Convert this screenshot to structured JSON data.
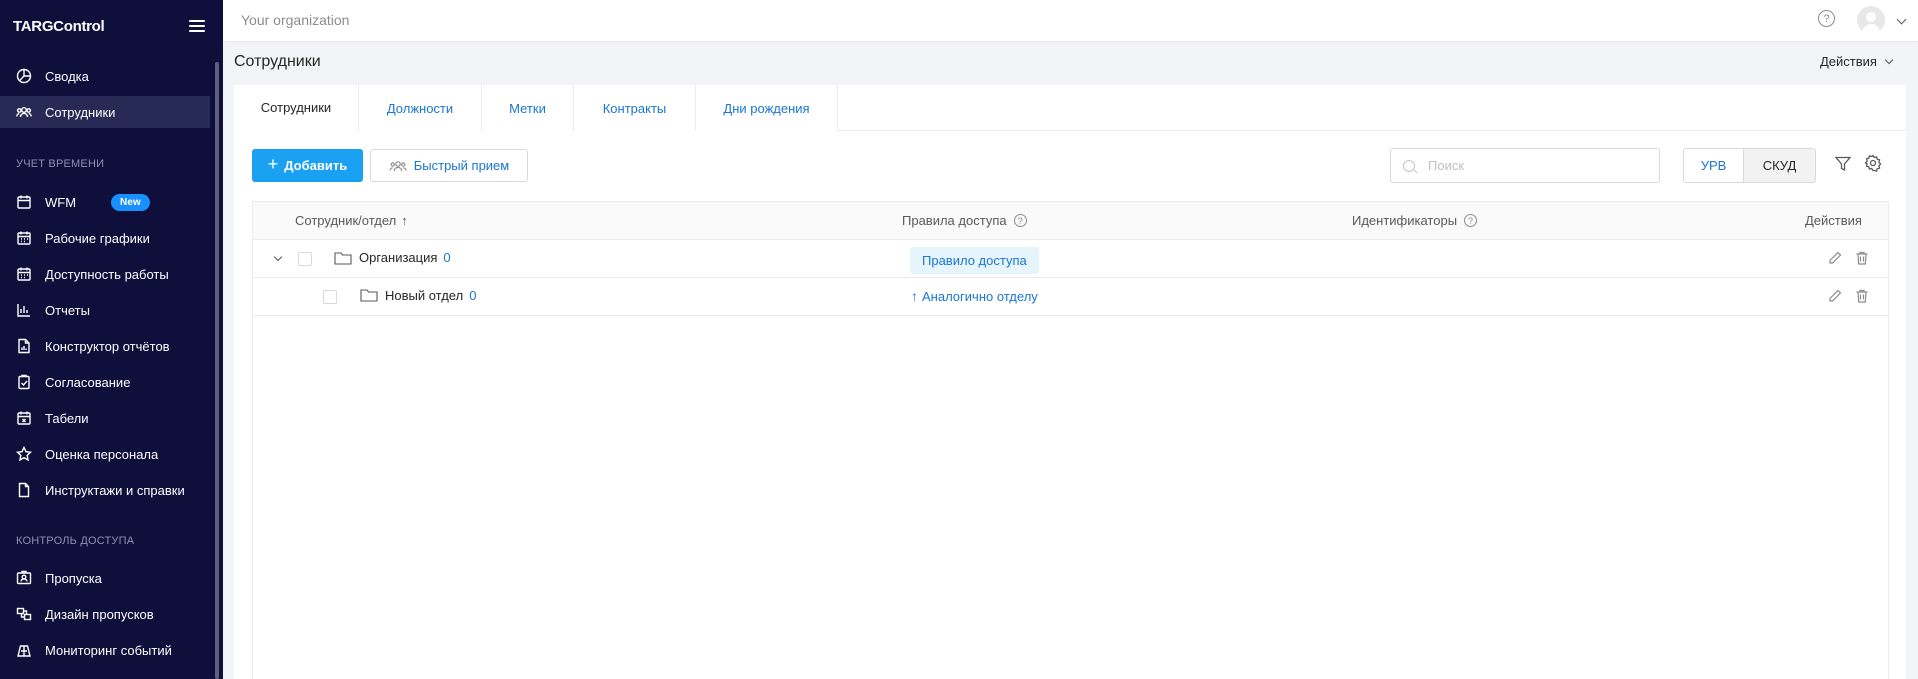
{
  "sidebar": {
    "logo": "TARGControl",
    "items_top": [
      {
        "label": "Сводка",
        "icon": "pie-chart-icon"
      },
      {
        "label": "Сотрудники",
        "icon": "users-icon",
        "active": true
      }
    ],
    "section_time": "УЧЕТ ВРЕМЕНИ",
    "items_time": [
      {
        "label": "WFM",
        "icon": "calendar-icon",
        "badge": "New"
      },
      {
        "label": "Рабочие графики",
        "icon": "calendar-icon"
      },
      {
        "label": "Доступность работы",
        "icon": "calendar-icon"
      },
      {
        "label": "Отчеты",
        "icon": "bar-chart-icon"
      },
      {
        "label": "Конструктор отчётов",
        "icon": "file-chart-icon"
      },
      {
        "label": "Согласование",
        "icon": "clipboard-check-icon"
      },
      {
        "label": "Табели",
        "icon": "calendar-x-icon"
      },
      {
        "label": "Оценка персонала",
        "icon": "star-icon"
      },
      {
        "label": "Инструктажи и справки",
        "icon": "file-icon"
      }
    ],
    "section_access": "КОНТРОЛЬ ДОСТУПА",
    "items_access": [
      {
        "label": "Пропуска",
        "icon": "badge-icon"
      },
      {
        "label": "Дизайн пропусков",
        "icon": "design-icon"
      },
      {
        "label": "Мониторинг событий",
        "icon": "monitor-icon"
      }
    ]
  },
  "header": {
    "org": "Your organization",
    "help": "?"
  },
  "page": {
    "title": "Сотрудники",
    "actions": "Действия"
  },
  "tabs": [
    "Сотрудники",
    "Должности",
    "Метки",
    "Контракты",
    "Дни рождения"
  ],
  "toolbar": {
    "add": "Добавить",
    "quick": "Быстрый прием",
    "search_placeholder": "Поиск",
    "seg1": "УРВ",
    "seg2": "СКУД"
  },
  "table": {
    "columns": {
      "name": "Сотрудник/отдел",
      "sort": "↑",
      "rules": "Правила доступа",
      "ids": "Идентификаторы",
      "actions": "Действия"
    },
    "rows": [
      {
        "name": "Организация",
        "count": "0",
        "rule": "Правило доступа"
      },
      {
        "name": "Новый отдел",
        "count": "0",
        "rule": "Аналогично отделу"
      }
    ]
  },
  "colors": {
    "sidebar_bg": "#0e0f3b",
    "accent": "#1ba1f2",
    "link": "#1976d2"
  }
}
